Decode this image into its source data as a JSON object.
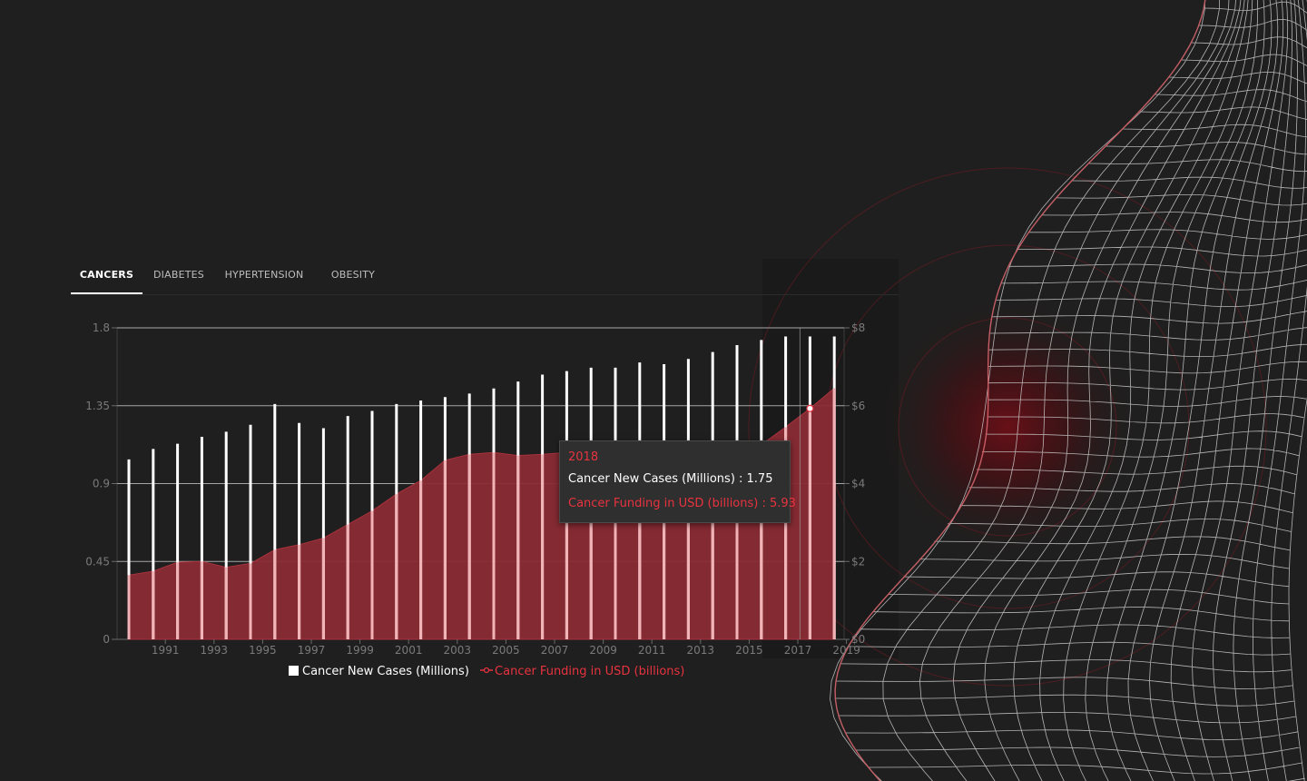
{
  "tabs": [
    {
      "label": "CANCERS",
      "active": true
    },
    {
      "label": "DIABETES",
      "active": false
    },
    {
      "label": "HYPERTENSION",
      "active": false
    },
    {
      "label": "OBESITY",
      "active": false
    }
  ],
  "colors": {
    "background": "#1f1f1f",
    "bars": "#ffffff",
    "area": "#8a2b34",
    "accent": "#e8333f",
    "gridline": "#bdbdbd"
  },
  "tooltip": {
    "year": "2018",
    "line1": "Cancer New Cases (Millions) : 1.75",
    "line2": "Cancer Funding in USD (billions) : 5.93"
  },
  "legend": {
    "series1": "Cancer New Cases (Millions)",
    "series2": "Cancer Funding in USD (billions)"
  },
  "chart_data": {
    "type": "bar",
    "title": "",
    "xlabel": "",
    "ylabel": "",
    "x": [
      1990,
      1991,
      1992,
      1993,
      1994,
      1995,
      1996,
      1997,
      1998,
      1999,
      2000,
      2001,
      2002,
      2003,
      2004,
      2005,
      2006,
      2007,
      2008,
      2009,
      2010,
      2011,
      2012,
      2013,
      2014,
      2015,
      2016,
      2017,
      2018,
      2019
    ],
    "xtick_labels": [
      "1991",
      "1993",
      "1995",
      "1997",
      "1999",
      "2001",
      "2003",
      "2005",
      "2007",
      "2009",
      "2011",
      "2013",
      "2015",
      "2017",
      "2019"
    ],
    "ylim": [
      0,
      1.8
    ],
    "yticks": [
      "0",
      "0.45",
      "0.9",
      "1.35",
      "1.8"
    ],
    "y2lim": [
      0,
      8
    ],
    "y2ticks": [
      "$0",
      "$2",
      "$4",
      "$6",
      "$8"
    ],
    "grid": true,
    "legend_position": "bottom",
    "series": [
      {
        "name": "Cancer New Cases (Millions)",
        "type": "bar",
        "axis": "left",
        "color": "#ffffff",
        "values": [
          1.04,
          1.1,
          1.13,
          1.17,
          1.2,
          1.24,
          1.36,
          1.25,
          1.22,
          1.29,
          1.32,
          1.36,
          1.38,
          1.4,
          1.42,
          1.45,
          1.49,
          1.53,
          1.55,
          1.57,
          1.57,
          1.6,
          1.59,
          1.62,
          1.66,
          1.7,
          1.73,
          1.75,
          1.75,
          1.75
        ]
      },
      {
        "name": "Cancer Funding in USD (billions)",
        "type": "area",
        "axis": "right",
        "color": "#e8333f",
        "values": [
          1.65,
          1.75,
          1.98,
          2.0,
          1.85,
          1.95,
          2.3,
          2.43,
          2.6,
          2.95,
          3.3,
          3.73,
          4.08,
          4.6,
          4.75,
          4.8,
          4.72,
          4.75,
          4.8,
          4.7,
          4.75,
          4.7,
          4.68,
          4.72,
          4.7,
          4.8,
          5.0,
          5.45,
          5.93,
          6.45
        ]
      }
    ]
  }
}
